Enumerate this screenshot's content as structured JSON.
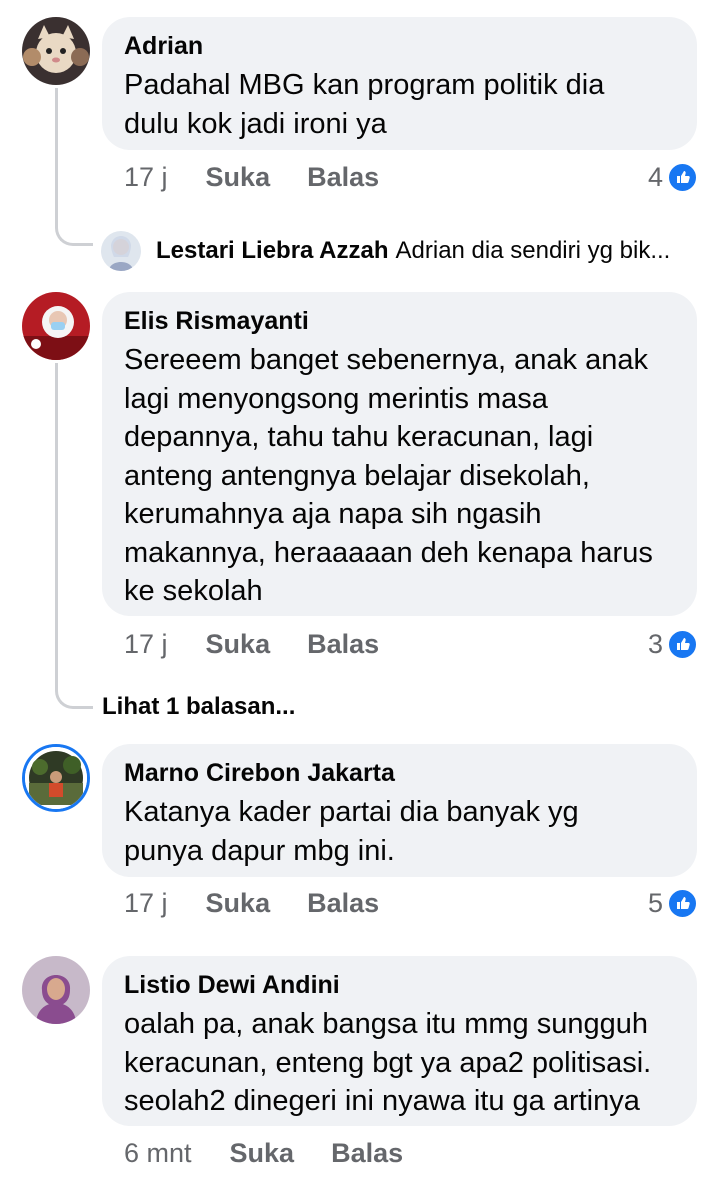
{
  "comments": [
    {
      "author": "Adrian",
      "lines": [
        "Padahal MBG kan program politik dia",
        "dulu kok jadi ironi ya"
      ],
      "time": "17 j",
      "like_label": "Suka",
      "reply_label": "Balas",
      "reaction_count": "4"
    },
    {
      "author": "Elis Rismayanti",
      "lines": [
        "Sereeem banget sebenernya, anak anak",
        "lagi menyongsong merintis masa",
        "depannya, tahu tahu keracunan, lagi",
        "anteng antengnya belajar disekolah,",
        "kerumahnya aja napa sih ngasih",
        "makannya, heraaaaan deh kenapa harus",
        "ke sekolah"
      ],
      "time": "17 j",
      "like_label": "Suka",
      "reply_label": "Balas",
      "reaction_count": "3"
    },
    {
      "author": "Marno Cirebon Jakarta",
      "lines": [
        "Katanya kader partai dia banyak yg",
        "punya dapur mbg ini."
      ],
      "time": "17 j",
      "like_label": "Suka",
      "reply_label": "Balas",
      "reaction_count": "5"
    },
    {
      "author": "Listio Dewi Andini",
      "lines": [
        "oalah pa, anak bangsa itu mmg sungguh",
        "keracunan, enteng bgt ya apa2 politisasi.",
        "seolah2 dinegeri ini nyawa itu ga artinya"
      ],
      "time": "6 mnt",
      "like_label": "Suka",
      "reply_label": "Balas"
    }
  ],
  "reply_preview": {
    "author": "Lestari Liebra Azzah",
    "text": "Adrian dia sendiri yg bik..."
  },
  "see_replies": "Lihat 1 balasan...",
  "colors": {
    "bubble": "#f0f2f5",
    "meta_text": "#65676b",
    "like_blue": "#1877f2",
    "thread_line": "#ced0d4"
  },
  "icons": {
    "reaction": "like-thumb-icon"
  }
}
